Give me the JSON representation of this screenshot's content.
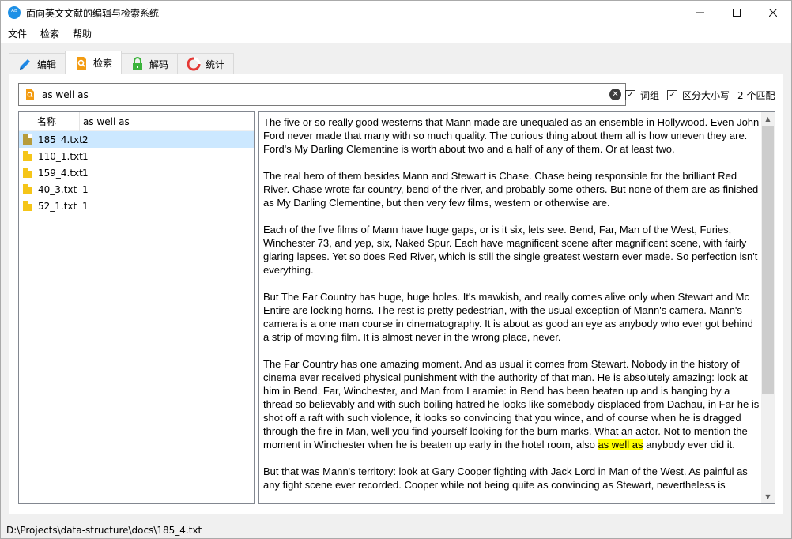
{
  "window": {
    "title": "面向英文文献的编辑与检索系统",
    "icon_text": "ᴬᴮ"
  },
  "menu": [
    "文件",
    "检索",
    "帮助"
  ],
  "tabs": [
    {
      "label": "编辑",
      "icon": "pencil-icon"
    },
    {
      "label": "检索",
      "icon": "search-document-icon"
    },
    {
      "label": "解码",
      "icon": "lock-icon"
    },
    {
      "label": "统计",
      "icon": "pie-chart-icon"
    }
  ],
  "search": {
    "value": "as well as",
    "whole_word_label": "词组",
    "case_sensitive_label": "区分大小写",
    "match_count": "2 个匹配"
  },
  "file_list": {
    "col_name": "名称",
    "col_count": "as well as",
    "rows": [
      {
        "name": "185_4.txt",
        "count": "2"
      },
      {
        "name": "110_1.txt",
        "count": "1"
      },
      {
        "name": "159_4.txt",
        "count": "1"
      },
      {
        "name": "40_3.txt",
        "count": "1"
      },
      {
        "name": "52_1.txt",
        "count": "1"
      }
    ]
  },
  "document": {
    "p1": "The five or so really good westerns that Mann made are unequaled as an ensemble in Hollywood. Even John Ford never made that many with so much quality. The curious thing about them all is how uneven they are. Ford's My Darling Clementine is worth about two and a half of any of them. Or at least two.",
    "p2": "The real hero of them besides Mann and Stewart is Chase. Chase being responsible for the brilliant Red River. Chase wrote far country, bend of the river, and probably some others. But none of them are as finished as My Darling Clementine, but then very few films, western or otherwise are.",
    "p3": "Each of the five films of Mann have huge gaps, or is it six, lets see. Bend, Far, Man of the West, Furies, Winchester 73, and yep, six, Naked Spur. Each have magnificent scene after magnificent scene, with fairly glaring lapses. Yet so does Red River, which is still the single greatest western ever made. So perfection isn't everything.",
    "p4": "But The Far Country has huge, huge holes. It's mawkish, and really comes alive only when Stewart and Mc Entire are locking horns. The rest is pretty pedestrian, with the usual exception of Mann's camera. Mann's camera is a one man course in cinematography. It is about as good an eye as anybody who ever got behind a strip of moving film. It is almost never in the wrong place, never.",
    "p5_before": "The Far Country has one amazing moment. And as usual it comes from Stewart. Nobody in the history of cinema ever received physical punishment with the authority of that man. He is absolutely amazing: look at him in Bend, Far, Winchester, and Man from Laramie: in Bend has been beaten up and is hanging by a thread so believably and with such boiling hatred he looks like somebody displaced from Dachau, in Far he is shot off a raft with such violence, it looks so convincing that you wince, and of course when he is dragged through the fire in Man, well you find yourself looking for the burn marks. What an actor. Not to mention the moment in Winchester when he is beaten up early in the hotel room, also ",
    "p5_match": "as well as",
    "p5_after": " anybody ever did it.",
    "p6": "But that was Mann's territory: look at Gary Cooper fighting with Jack Lord in Man of the West. As painful as any fight scene ever recorded. Cooper while not being quite as convincing as Stewart, nevertheless is"
  },
  "status": "D:\\Projects\\data-structure\\docs\\185_4.txt"
}
